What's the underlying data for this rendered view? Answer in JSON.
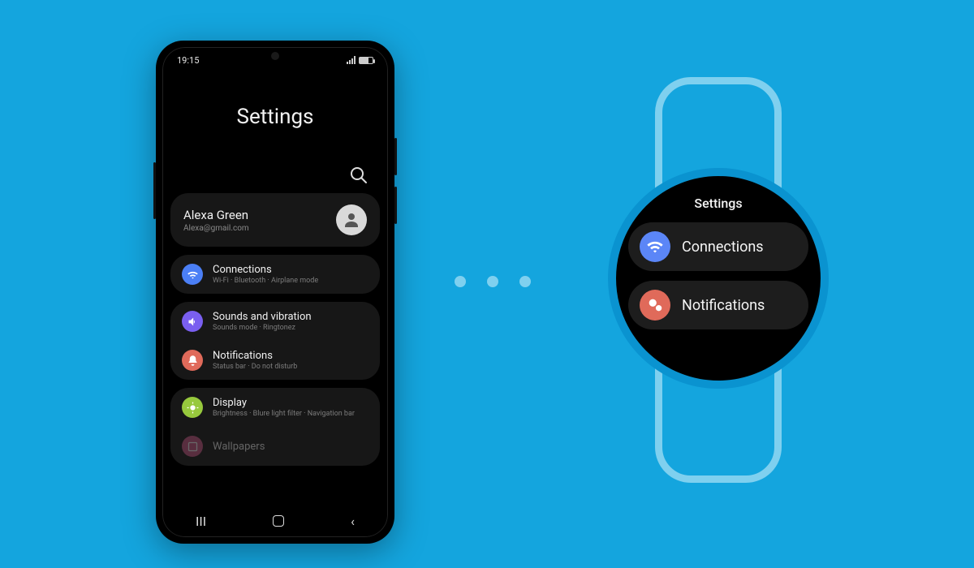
{
  "phone": {
    "status": {
      "time": "19:15"
    },
    "title": "Settings",
    "profile": {
      "name": "Alexa Green",
      "email": "Alexa@gmail.com"
    },
    "rows": [
      {
        "title": "Connections",
        "subtitle": "Wi-Fi  ·  Bluetooth  ·  Airplane mode"
      },
      {
        "title": "Sounds and vibration",
        "subtitle": "Sounds mode  ·  Ringtonez"
      },
      {
        "title": "Notifications",
        "subtitle": "Status bar  ·  Do not disturb"
      },
      {
        "title": "Display",
        "subtitle": "Brightness  ·  Blure light filter  ·  Navigation bar"
      },
      {
        "title": "Wallpapers",
        "subtitle": ""
      }
    ]
  },
  "watch": {
    "title": "Settings",
    "rows": [
      {
        "label": "Connections"
      },
      {
        "label": "Notifications"
      }
    ]
  }
}
